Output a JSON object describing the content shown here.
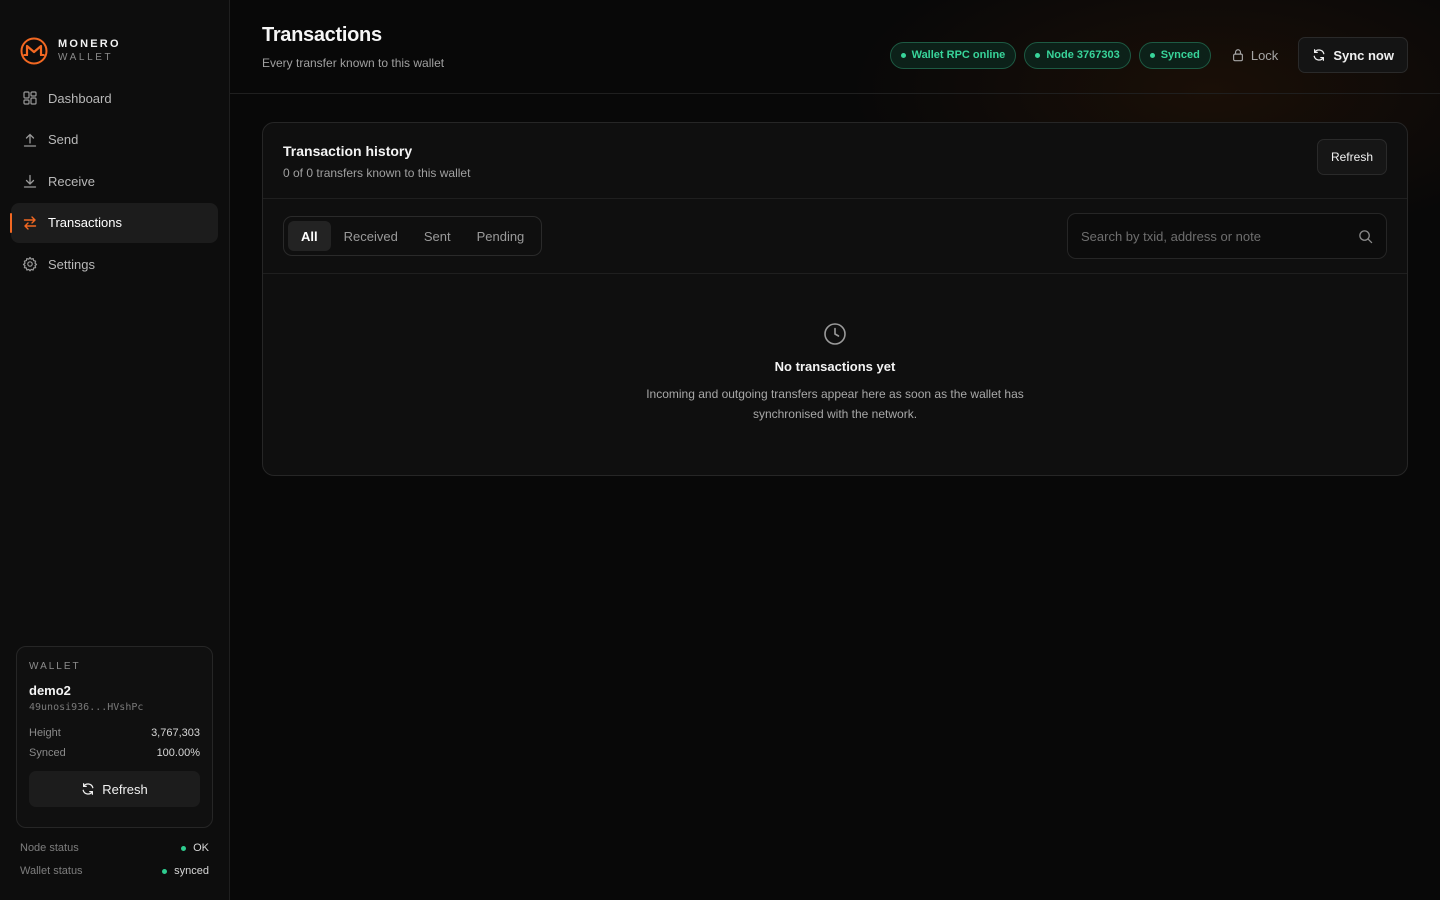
{
  "brand": {
    "name": "MONERO",
    "sub": "WALLET",
    "accent": "#f26822"
  },
  "sidebar": {
    "items": [
      {
        "label": "Dashboard",
        "icon": "grid-icon"
      },
      {
        "label": "Send",
        "icon": "upload-icon"
      },
      {
        "label": "Receive",
        "icon": "download-icon"
      },
      {
        "label": "Transactions",
        "icon": "transfer-arrows-icon",
        "active": true
      },
      {
        "label": "Settings",
        "icon": "gear-icon"
      }
    ],
    "wallet": {
      "label": "WALLET",
      "name": "demo2",
      "address": "49unosi936...HVshPc",
      "height_label": "Height",
      "height_value": "3,767,303",
      "synced_label": "Synced",
      "synced_value": "100.00%",
      "refresh_label": "Refresh"
    },
    "node_status": {
      "label": "Node status",
      "value": "OK"
    },
    "wallet_status": {
      "label": "Wallet status",
      "value": "synced"
    }
  },
  "header": {
    "title": "Transactions",
    "subtitle": "Every transfer known to this wallet",
    "pills": [
      "Wallet RPC online",
      "Node 3767303",
      "Synced"
    ],
    "lock_label": "Lock",
    "sync_label": "Sync now"
  },
  "history": {
    "title": "Transaction history",
    "subtitle": "0 of 0 transfers known to this wallet",
    "refresh_label": "Refresh",
    "filters": [
      "All",
      "Received",
      "Sent",
      "Pending"
    ],
    "active_filter": "All",
    "search_placeholder": "Search by txid, address or note",
    "empty_title": "No transactions yet",
    "empty_desc": "Incoming and outgoing transfers appear here as soon as the wallet has synchronised with the network."
  }
}
